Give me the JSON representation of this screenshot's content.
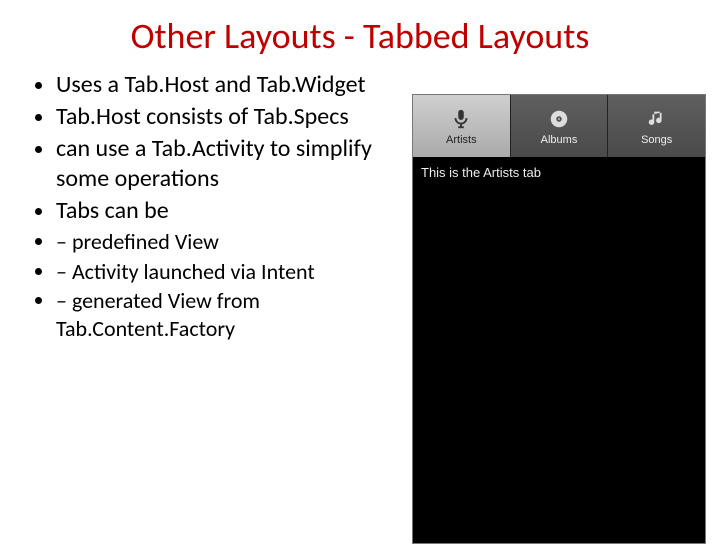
{
  "title": "Other Layouts - Tabbed Layouts",
  "bullets": [
    "Uses a Tab.Host and Tab.Widget",
    "Tab.Host consists of Tab.Specs",
    "can use a Tab.Activity to simplify some operations",
    "Tabs can be"
  ],
  "subbullets": [
    "predefined View",
    "Activity launched via Intent",
    "generated View from Tab.Content.Factory"
  ],
  "phone": {
    "tabs": [
      {
        "label": "Artists",
        "icon": "mic-icon",
        "active": true
      },
      {
        "label": "Albums",
        "icon": "album-icon",
        "active": false
      },
      {
        "label": "Songs",
        "icon": "note-icon",
        "active": false
      }
    ],
    "body_text": "This is the Artists tab"
  }
}
